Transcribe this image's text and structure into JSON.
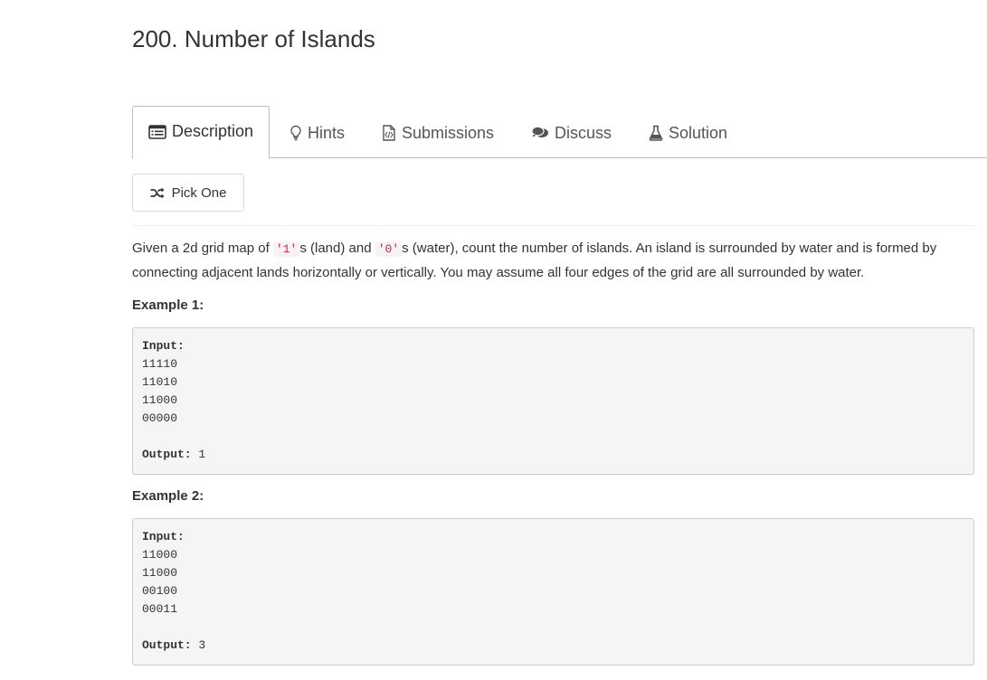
{
  "problem": {
    "title": "200. Number of Islands"
  },
  "tabs": [
    {
      "label": "Description",
      "icon": "list-icon",
      "active": true
    },
    {
      "label": "Hints",
      "icon": "lightbulb-icon",
      "active": false
    },
    {
      "label": "Submissions",
      "icon": "code-file-icon",
      "active": false
    },
    {
      "label": "Discuss",
      "icon": "comments-icon",
      "active": false
    },
    {
      "label": "Solution",
      "icon": "flask-icon",
      "active": false
    }
  ],
  "pick_one": {
    "label": "Pick One",
    "icon": "shuffle-icon"
  },
  "description": {
    "part1": "Given a 2d grid map of ",
    "code1": "'1'",
    "part2": "s (land) and ",
    "code2": "'0'",
    "part3": "s (water), count the number of islands. An island is surrounded by water and is formed by connecting adjacent lands horizontally or vertically. You may assume all four edges of the grid are all surrounded by water."
  },
  "examples": [
    {
      "title": "Example 1:",
      "input_label": "Input:",
      "grid": [
        "11110",
        "11010",
        "11000",
        "00000"
      ],
      "output_label": "Output:",
      "output_value": "1"
    },
    {
      "title": "Example 2:",
      "input_label": "Input:",
      "grid": [
        "11000",
        "11000",
        "00100",
        "00011"
      ],
      "output_label": "Output:",
      "output_value": "3"
    }
  ],
  "colors": {
    "inline_code_text": "#c7254e",
    "inline_code_bg": "#f9f2f4",
    "pre_bg": "#f5f5f5",
    "border": "#cccccc"
  }
}
